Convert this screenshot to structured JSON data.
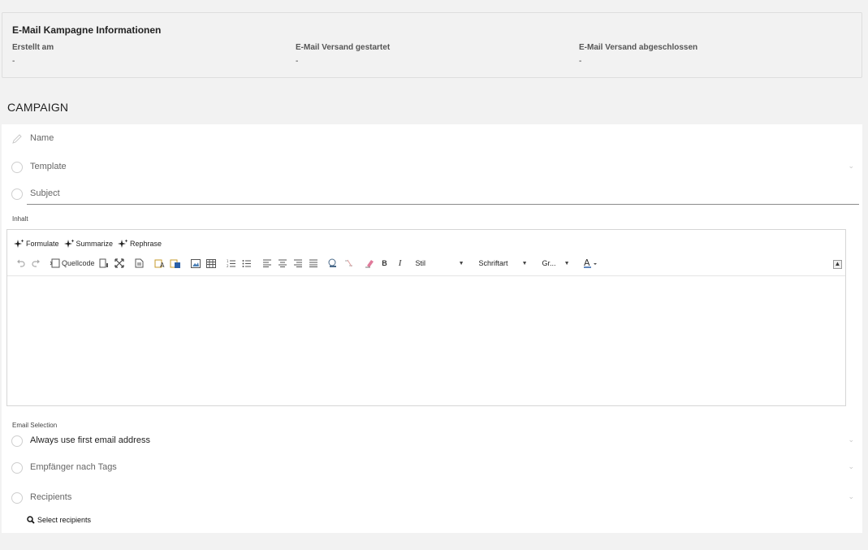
{
  "info": {
    "title": "E-Mail Kampagne Informationen",
    "created_label": "Erstellt am",
    "created_value": "-",
    "started_label": "E-Mail Versand gestartet",
    "started_value": "-",
    "finished_label": "E-Mail Versand abgeschlossen",
    "finished_value": "-"
  },
  "section_title": "CAMPAIGN",
  "form": {
    "name_label": "Name",
    "template_label": "Template",
    "subject_label": "Subject",
    "content_label": "Inhalt",
    "email_selection_label": "Email Selection",
    "always_first_label": "Always use first email address",
    "recipients_tags_label": "Empfänger nach Tags",
    "recipients_label": "Recipients",
    "select_recipients": "Select recipients"
  },
  "editor": {
    "ai_buttons": [
      "Formulate",
      "Summarize",
      "Rephrase"
    ],
    "source_label": "Quellcode",
    "style_combo": "Stil",
    "font_combo": "Schriftart",
    "size_combo": "Gr..."
  },
  "icons": [
    "pencil-icon",
    "sparkle-icon",
    "undo-icon",
    "redo-icon",
    "search-icon",
    "chevron-down-icon"
  ]
}
